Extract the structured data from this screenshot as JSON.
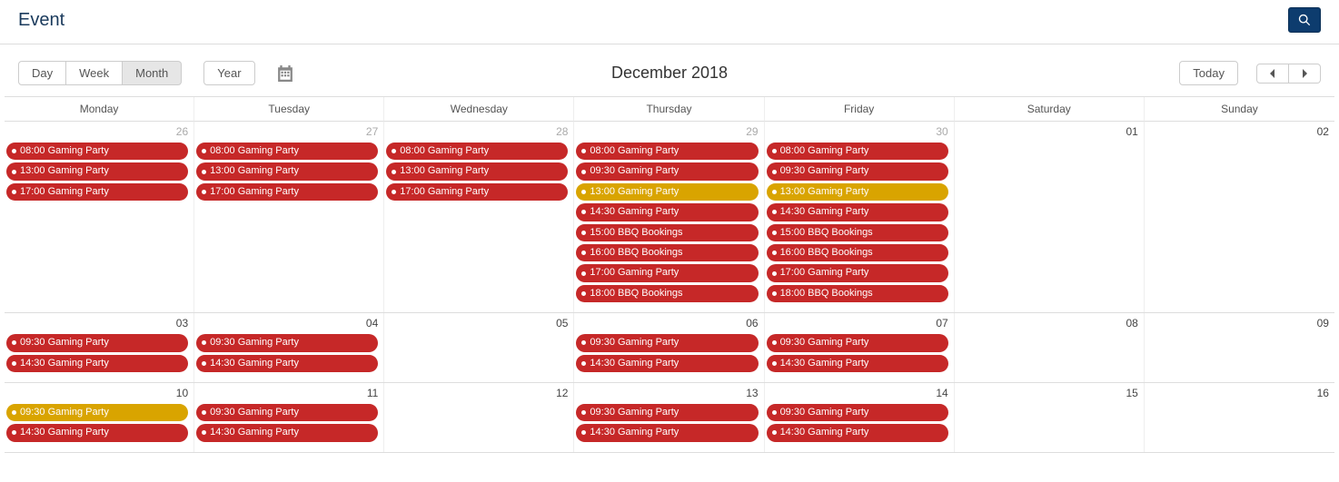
{
  "title": "Event",
  "monthLabel": "December 2018",
  "views": {
    "day": "Day",
    "week": "Week",
    "month": "Month",
    "year": "Year",
    "active": "month"
  },
  "today": "Today",
  "weekdays": [
    "Monday",
    "Tuesday",
    "Wednesday",
    "Thursday",
    "Friday",
    "Saturday",
    "Sunday"
  ],
  "weeks": [
    {
      "days": [
        {
          "num": "26",
          "other": true,
          "events": [
            {
              "label": "08:00 Gaming Party",
              "color": "red"
            },
            {
              "label": "13:00 Gaming Party",
              "color": "red"
            },
            {
              "label": "17:00 Gaming Party",
              "color": "red"
            }
          ]
        },
        {
          "num": "27",
          "other": true,
          "events": [
            {
              "label": "08:00 Gaming Party",
              "color": "red"
            },
            {
              "label": "13:00 Gaming Party",
              "color": "red"
            },
            {
              "label": "17:00 Gaming Party",
              "color": "red"
            }
          ]
        },
        {
          "num": "28",
          "other": true,
          "events": [
            {
              "label": "08:00 Gaming Party",
              "color": "red"
            },
            {
              "label": "13:00 Gaming Party",
              "color": "red"
            },
            {
              "label": "17:00 Gaming Party",
              "color": "red"
            }
          ]
        },
        {
          "num": "29",
          "other": true,
          "events": [
            {
              "label": "08:00 Gaming Party",
              "color": "red"
            },
            {
              "label": "09:30 Gaming Party",
              "color": "red"
            },
            {
              "label": "13:00 Gaming Party",
              "color": "yellow"
            },
            {
              "label": "14:30 Gaming Party",
              "color": "red"
            },
            {
              "label": "15:00 BBQ Bookings",
              "color": "red"
            },
            {
              "label": "16:00 BBQ Bookings",
              "color": "red"
            },
            {
              "label": "17:00 Gaming Party",
              "color": "red"
            },
            {
              "label": "18:00 BBQ Bookings",
              "color": "red"
            }
          ]
        },
        {
          "num": "30",
          "other": true,
          "events": [
            {
              "label": "08:00 Gaming Party",
              "color": "red"
            },
            {
              "label": "09:30 Gaming Party",
              "color": "red"
            },
            {
              "label": "13:00 Gaming Party",
              "color": "yellow"
            },
            {
              "label": "14:30 Gaming Party",
              "color": "red"
            },
            {
              "label": "15:00 BBQ Bookings",
              "color": "red"
            },
            {
              "label": "16:00 BBQ Bookings",
              "color": "red"
            },
            {
              "label": "17:00 Gaming Party",
              "color": "red"
            },
            {
              "label": "18:00 BBQ Bookings",
              "color": "red"
            }
          ]
        },
        {
          "num": "01",
          "other": false,
          "events": []
        },
        {
          "num": "02",
          "other": false,
          "events": []
        }
      ]
    },
    {
      "days": [
        {
          "num": "03",
          "other": false,
          "events": [
            {
              "label": "09:30 Gaming Party",
              "color": "red"
            },
            {
              "label": "14:30 Gaming Party",
              "color": "red"
            }
          ]
        },
        {
          "num": "04",
          "other": false,
          "events": [
            {
              "label": "09:30 Gaming Party",
              "color": "red"
            },
            {
              "label": "14:30 Gaming Party",
              "color": "red"
            }
          ]
        },
        {
          "num": "05",
          "other": false,
          "events": []
        },
        {
          "num": "06",
          "other": false,
          "events": [
            {
              "label": "09:30 Gaming Party",
              "color": "red"
            },
            {
              "label": "14:30 Gaming Party",
              "color": "red"
            }
          ]
        },
        {
          "num": "07",
          "other": false,
          "events": [
            {
              "label": "09:30 Gaming Party",
              "color": "red"
            },
            {
              "label": "14:30 Gaming Party",
              "color": "red"
            }
          ]
        },
        {
          "num": "08",
          "other": false,
          "events": []
        },
        {
          "num": "09",
          "other": false,
          "events": []
        }
      ]
    },
    {
      "days": [
        {
          "num": "10",
          "other": false,
          "events": [
            {
              "label": "09:30 Gaming Party",
              "color": "yellow"
            },
            {
              "label": "14:30 Gaming Party",
              "color": "red"
            }
          ]
        },
        {
          "num": "11",
          "other": false,
          "events": [
            {
              "label": "09:30 Gaming Party",
              "color": "red"
            },
            {
              "label": "14:30 Gaming Party",
              "color": "red"
            }
          ]
        },
        {
          "num": "12",
          "other": false,
          "events": []
        },
        {
          "num": "13",
          "other": false,
          "events": [
            {
              "label": "09:30 Gaming Party",
              "color": "red"
            },
            {
              "label": "14:30 Gaming Party",
              "color": "red"
            }
          ]
        },
        {
          "num": "14",
          "other": false,
          "events": [
            {
              "label": "09:30 Gaming Party",
              "color": "red"
            },
            {
              "label": "14:30 Gaming Party",
              "color": "red"
            }
          ]
        },
        {
          "num": "15",
          "other": false,
          "events": []
        },
        {
          "num": "16",
          "other": false,
          "events": []
        }
      ]
    }
  ]
}
